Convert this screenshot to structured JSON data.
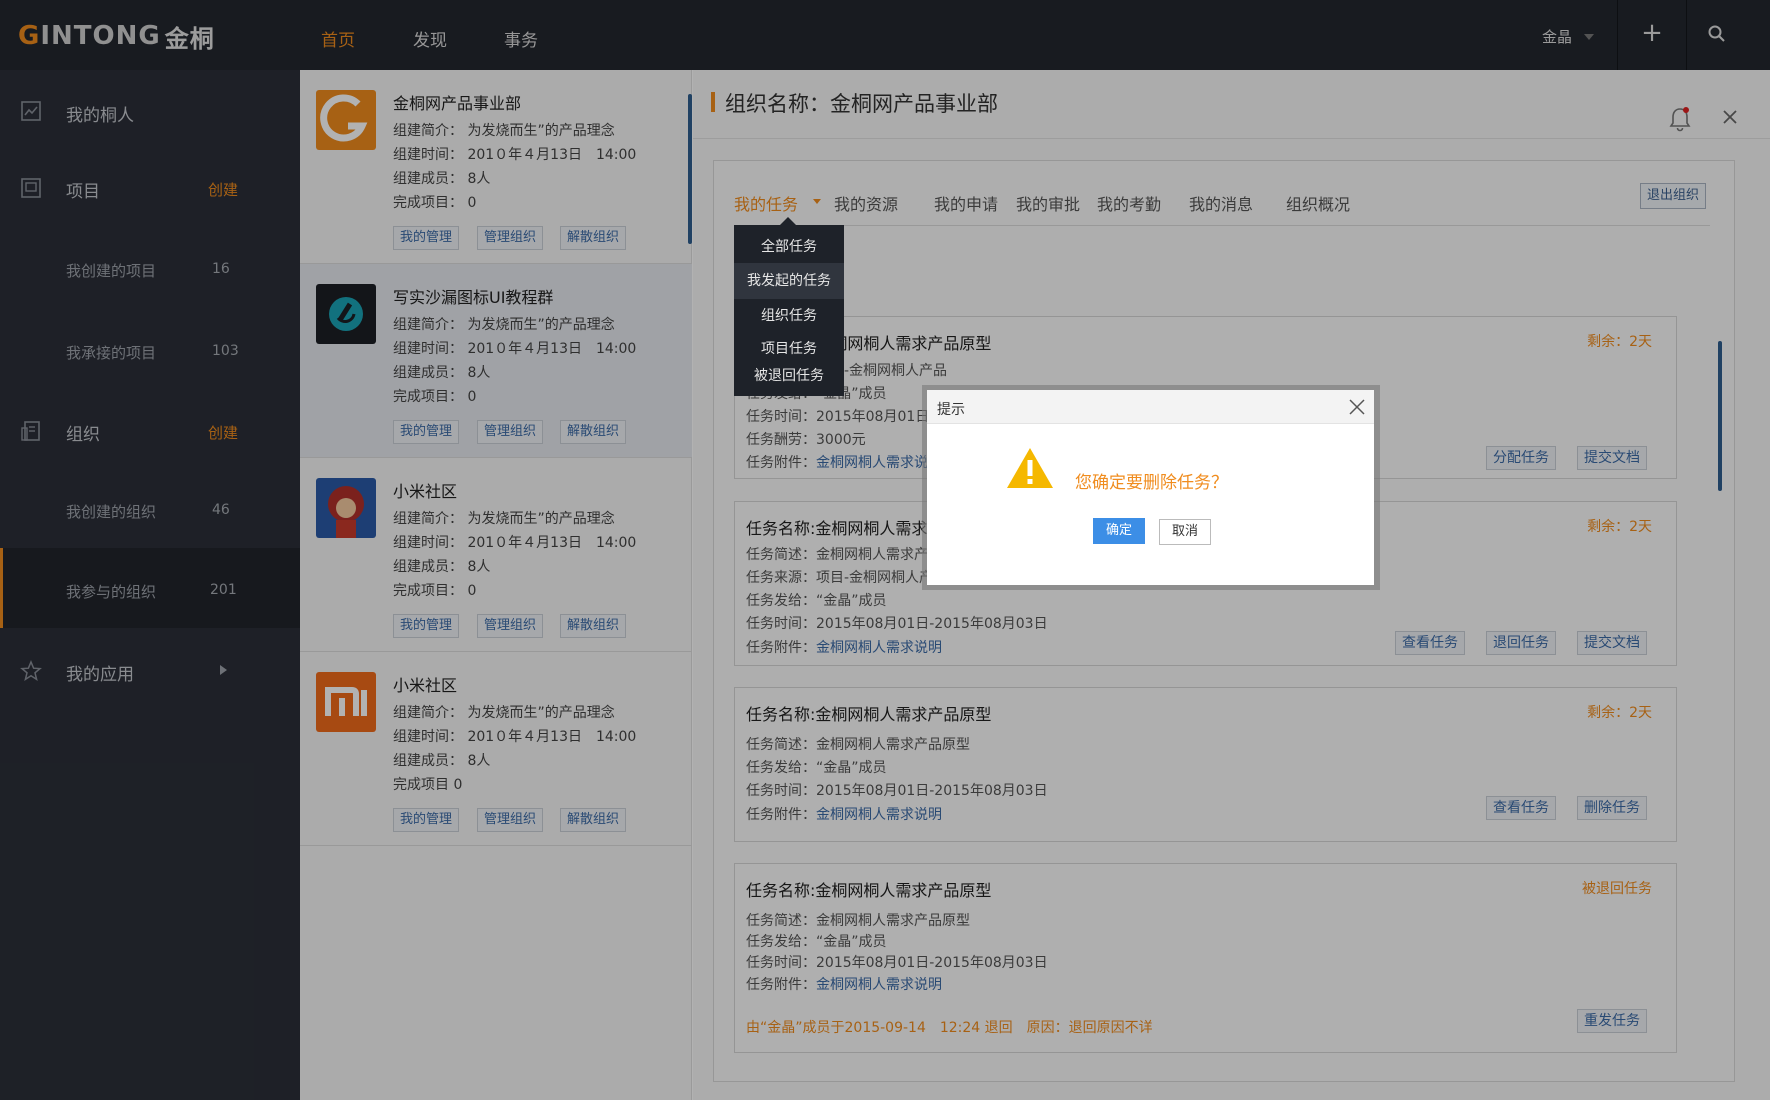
{
  "brand": {
    "logo_g": "G",
    "logo_rest": "INTONG",
    "logo_cn": "金桐"
  },
  "topnav": {
    "items": [
      "首页",
      "发现",
      "事务"
    ],
    "active": "首页"
  },
  "user": {
    "name": "金晶"
  },
  "sidebar": {
    "contacts": "我的桐人",
    "projects": "项目",
    "projects_create": "创建",
    "projects_created": {
      "label": "我创建的项目",
      "count": "16"
    },
    "projects_taken": {
      "label": "我承接的项目",
      "count": "103"
    },
    "org": "组织",
    "org_create": "创建",
    "org_created": {
      "label": "我创建的组织",
      "count": "46"
    },
    "org_joined": {
      "label": "我参与的组织",
      "count": "201"
    },
    "apps": "我的应用"
  },
  "orgs": [
    {
      "name": "金桐网产品事业部",
      "intro": "组建简介： 为发烧而生”的产品理念",
      "time": "组建时间： 201０年４月13日　14:00",
      "members": "组建成员： 8人",
      "done": "完成项目：  0",
      "btns": [
        "我的管理",
        "管理组织",
        "解散组织"
      ]
    },
    {
      "name": "写实沙漏图标UI教程群",
      "intro": "组建简介： 为发烧而生”的产品理念",
      "time": "组建时间： 201０年４月13日　14:00",
      "members": "组建成员： 8人",
      "done": "完成项目：  0",
      "btns": [
        "我的管理",
        "管理组织",
        "解散组织"
      ]
    },
    {
      "name": "小米社区",
      "intro": "组建简介： 为发烧而生”的产品理念",
      "time": "组建时间： 201０年４月13日　14:00",
      "members": "组建成员： 8人",
      "done": "完成项目：  0",
      "btns": [
        "我的管理",
        "管理组织",
        "解散组织"
      ]
    },
    {
      "name": "小米社区",
      "intro": "组建简介： 为发烧而生”的产品理念",
      "time": "组建时间： 201０年４月13日　14:00",
      "members": "组建成员： 8人",
      "done": "完成项目     0",
      "btns": [
        "我的管理",
        "管理组织",
        "解散组织"
      ]
    }
  ],
  "main": {
    "title": "组织名称：金桐网产品事业部",
    "tabs": [
      "我的任务",
      "我的资源",
      "我的申请",
      "我的审批",
      "我的考勤",
      "我的消息",
      "组织概况"
    ],
    "exit": "退出组织"
  },
  "dropdown": [
    "全部任务",
    "我发起的任务",
    "组织任务",
    "项目任务",
    "被退回任务"
  ],
  "cards": [
    {
      "title": "任务名称:金桐网桐人需求产品原型",
      "remain": "剩余：2天",
      "lines": [
        "任务来源：项目-金桐网桐人产品",
        "任务发给：“金晶”成员",
        "任务时间：2015年08月01日-2015年08月03日",
        "任务酬劳：3000元"
      ],
      "attach_label": "任务附件：",
      "attach": "金桐网桐人需求说明",
      "btns": [
        "分配任务",
        "提交文档"
      ]
    },
    {
      "title": "任务名称:金桐网桐人需求产品原型",
      "remain": "剩余：2天",
      "lines": [
        "任务简述：金桐网桐人需求产品原型",
        "任务来源：项目-金桐网桐人产品",
        "任务发给：“金晶”成员",
        "任务时间：2015年08月01日-2015年08月03日"
      ],
      "attach_label": "任务附件：",
      "attach": "金桐网桐人需求说明",
      "btns": [
        "查看任务",
        "退回任务",
        "提交文档"
      ]
    },
    {
      "title": "任务名称:金桐网桐人需求产品原型",
      "remain": "剩余：2天",
      "lines": [
        "任务简述：金桐网桐人需求产品原型",
        "任务发给：“金晶”成员",
        "任务时间：2015年08月01日-2015年08月03日"
      ],
      "attach_label": "任务附件：",
      "attach": "金桐网桐人需求说明",
      "btns": [
        "查看任务",
        "删除任务"
      ]
    },
    {
      "title": "任务名称:金桐网桐人需求产品原型",
      "remain": "被退回任务",
      "lines": [
        "任务简述：金桐网桐人需求产品原型",
        "任务发给：“金晶”成员",
        "任务时间：2015年08月01日-2015年08月03日"
      ],
      "attach_label": "任务附件：",
      "attach": "金桐网桐人需求说明",
      "note": "由“金晶”成员于2015-09-14　12:24 退回　原因：退回原因不详",
      "btns": [
        "重发任务"
      ]
    }
  ],
  "dialog": {
    "title": "提示",
    "message": "您确定要删除任务？",
    "ok": "确定",
    "cancel": "取消"
  },
  "colors": {
    "accent": "#f08c1e",
    "link": "#3b6aa6",
    "topbar": "#23272f",
    "sidebar": "#2b2f38",
    "primary_btn": "#3c8ee6"
  }
}
